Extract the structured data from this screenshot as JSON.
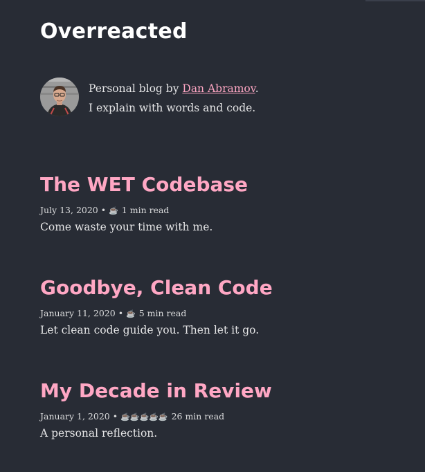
{
  "site": {
    "title": "Overreacted"
  },
  "bio": {
    "prefix": "Personal blog by ",
    "author": "Dan Abramov",
    "suffix": ".",
    "line2": "I explain with words and code."
  },
  "posts": [
    {
      "title": "The WET Codebase",
      "date": "July 13, 2020",
      "separator": "•",
      "cups": "☕",
      "read_time": "1 min read",
      "excerpt": "Come waste your time with me."
    },
    {
      "title": "Goodbye, Clean Code",
      "date": "January 11, 2020",
      "separator": "•",
      "cups": "☕",
      "read_time": "5 min read",
      "excerpt": "Let clean code guide you. Then let it go."
    },
    {
      "title": "My Decade in Review",
      "date": "January 1, 2020",
      "separator": "•",
      "cups": "☕☕☕☕☕",
      "read_time": "26 min read",
      "excerpt": "A personal reflection."
    }
  ],
  "colors": {
    "background": "#282c35",
    "accent": "#ffa7c4",
    "text": "#ffffff"
  },
  "icons": {
    "read_time": "coffee-cup-icon"
  }
}
